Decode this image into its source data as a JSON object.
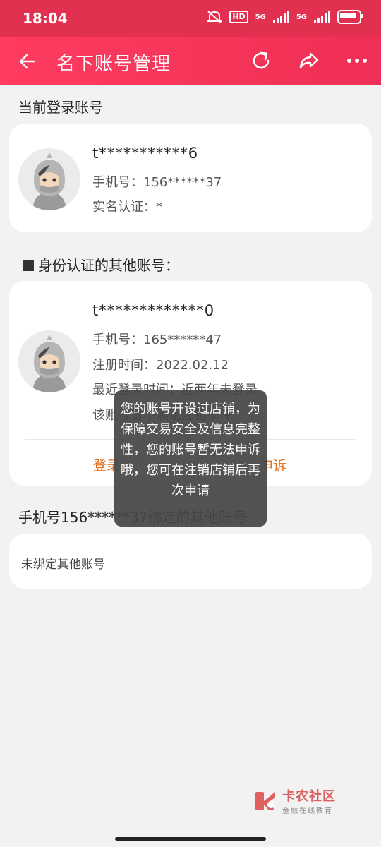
{
  "status_bar": {
    "time": "18:04",
    "hd_label": "HD",
    "net1": "5G",
    "net2": "5G"
  },
  "nav": {
    "title": "名下账号管理",
    "icons": [
      "back-arrow-icon",
      "refresh-icon",
      "share-icon",
      "more-icon"
    ]
  },
  "current_section": {
    "label": "当前登录账号",
    "account": {
      "name": "t***********6",
      "phone_label": "手机号：",
      "phone": "156******37",
      "realname_label": "实名认证：",
      "realname": "*"
    }
  },
  "other_section": {
    "label": "身份认证的其他账号：",
    "account": {
      "name": "t*************0",
      "phone_label": "手机号：",
      "phone": "165******47",
      "reg_label": "注册时间：",
      "reg_date": "2022.02.12",
      "last_login_label": "最近登录时间：",
      "last_login": "近两年未登录",
      "status_text": "该账号暂不满足注销条件",
      "login_action": "登录",
      "appeal_action": "申诉"
    }
  },
  "bound_section": {
    "label": "手机号156******37绑定的其他账号",
    "empty_text": "未绑定其他账号"
  },
  "toast": {
    "text": "您的账号开设过店铺，为保障交易安全及信息完整性，您的账号暂无法申诉哦，您可在注销店铺后再次申请"
  },
  "watermark": {
    "brand": "卡农社区",
    "slogan": "金融在线教育"
  },
  "colors": {
    "nav": "#f5345a",
    "accent": "#e36c1b"
  }
}
